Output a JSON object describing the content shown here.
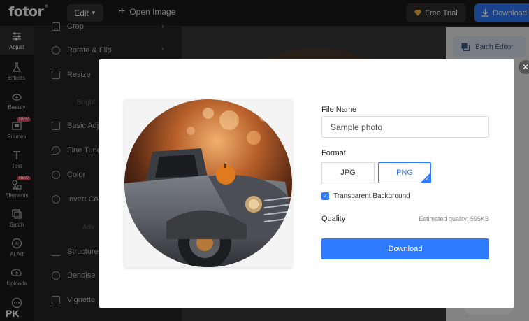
{
  "topbar": {
    "logo": "fotor",
    "logo_mark": "®",
    "edit_label": "Edit",
    "open_image_label": "Open Image",
    "free_trial_label": "Free Trial",
    "download_label": "Download"
  },
  "rail": {
    "items": [
      {
        "label": "Adjust",
        "icon": "sliders-icon"
      },
      {
        "label": "Effects",
        "icon": "flask-icon"
      },
      {
        "label": "Beauty",
        "icon": "eye-icon"
      },
      {
        "label": "Frames",
        "icon": "frame-icon",
        "badge": "NEW"
      },
      {
        "label": "Text",
        "icon": "text-icon"
      },
      {
        "label": "Elements",
        "icon": "shapes-icon",
        "badge": "NEW"
      },
      {
        "label": "Batch",
        "icon": "batch-icon"
      },
      {
        "label": "AI Art",
        "icon": "ai-icon"
      },
      {
        "label": "Uploads",
        "icon": "upload-icon"
      },
      {
        "label": "",
        "icon": "more-icon"
      }
    ],
    "watermark": "PK"
  },
  "tools": {
    "items": [
      {
        "label": "Crop",
        "has_arrow": true
      },
      {
        "label": "Rotate & Flip",
        "has_arrow": true
      },
      {
        "label": "Resize",
        "has_arrow": false
      },
      {
        "label": "Basic Adj",
        "has_arrow": false
      },
      {
        "label": "Fine Tune",
        "has_arrow": false
      },
      {
        "label": "Color",
        "has_arrow": false
      },
      {
        "label": "Invert Co",
        "has_arrow": false
      },
      {
        "label": "Structure",
        "has_arrow": false
      },
      {
        "label": "Denoise",
        "has_arrow": false
      },
      {
        "label": "Vignette",
        "has_arrow": false
      }
    ],
    "section_bright": "Bright",
    "section_adv": "Adv"
  },
  "right_panel": {
    "batch_editor_label": "Batch Editor"
  },
  "modal": {
    "file_name_label": "File Name",
    "file_name_value": "Sample photo",
    "format_label": "Format",
    "formats": [
      "JPG",
      "PNG"
    ],
    "selected_format": "PNG",
    "transparent_label": "Transparent Background",
    "transparent_checked": true,
    "quality_label": "Quality",
    "estimated_quality": "Estimated quality: 595KB",
    "download_label": "Download"
  },
  "colors": {
    "accent": "#2f7bff",
    "dark_bg": "#1b1b1b",
    "badge": "#e8445a"
  }
}
